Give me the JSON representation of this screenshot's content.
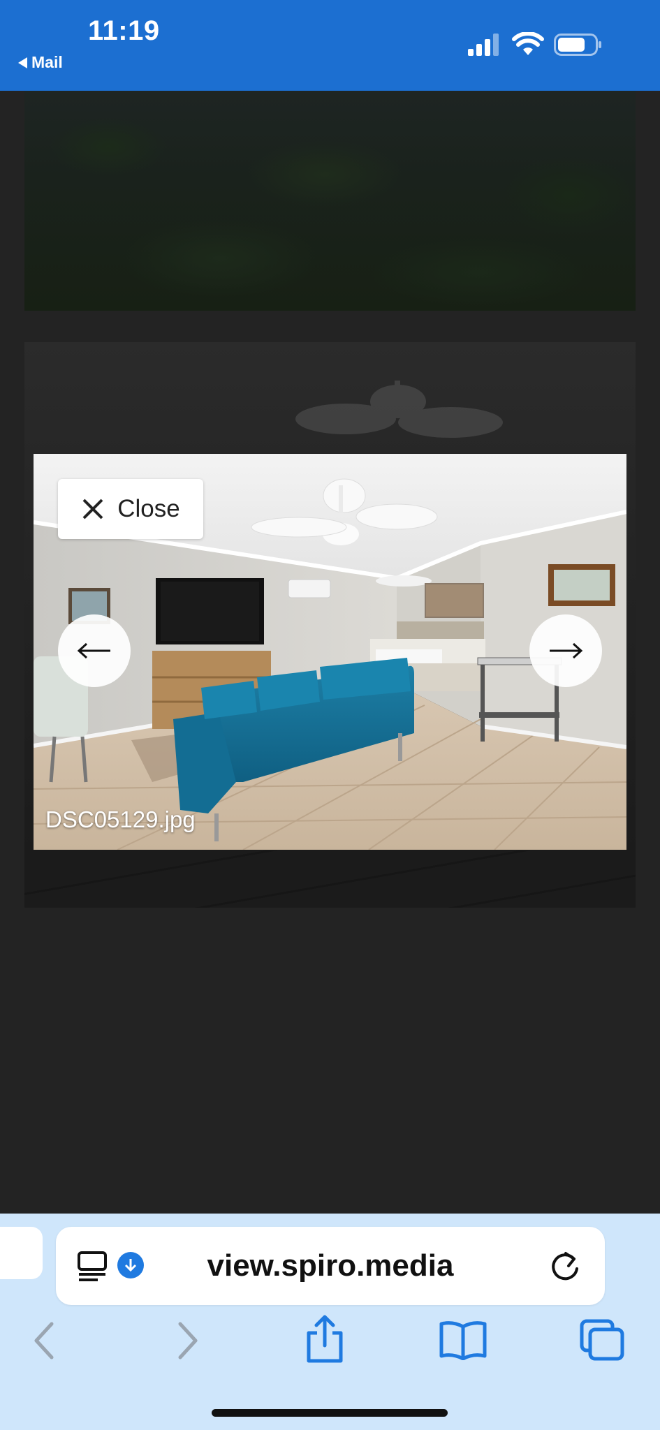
{
  "status_bar": {
    "time": "11:19",
    "back_label": "Mail",
    "background_color": "#1c6fd1"
  },
  "lightbox": {
    "close_label": "Close",
    "filename": "DSC05129.jpg",
    "prev_icon": "arrow-left-icon",
    "next_icon": "arrow-right-icon"
  },
  "browser": {
    "url": "view.spiro.media",
    "icons": [
      "reader-icon",
      "download-icon",
      "reload-icon",
      "back-icon",
      "forward-icon",
      "share-icon",
      "bookmarks-icon",
      "tabs-icon"
    ],
    "accent_color": "#1f7ae0",
    "toolbar_color": "#cfe6fb"
  }
}
